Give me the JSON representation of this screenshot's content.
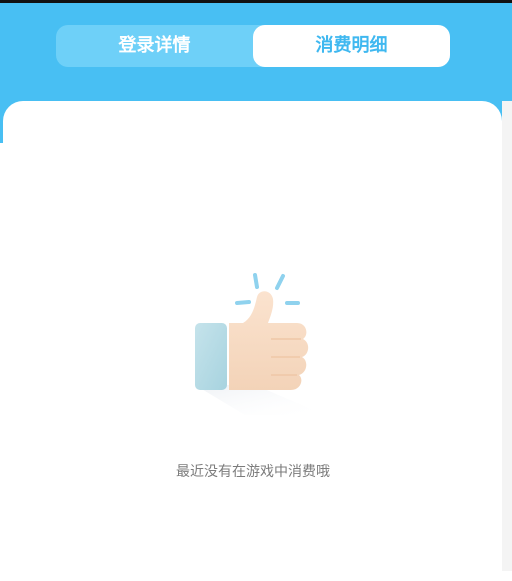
{
  "tabs": [
    {
      "label": "登录详情",
      "active": false
    },
    {
      "label": "消费明细",
      "active": true
    }
  ],
  "empty_state": {
    "message": "最近没有在游戏中消费哦",
    "illustration": "thumbs-up-icon"
  },
  "colors": {
    "header_blue": "#48bff3",
    "tab_track": "#6ed0f8",
    "active_tab_text": "#3fb8f0",
    "message_text": "#7c7c7c"
  }
}
